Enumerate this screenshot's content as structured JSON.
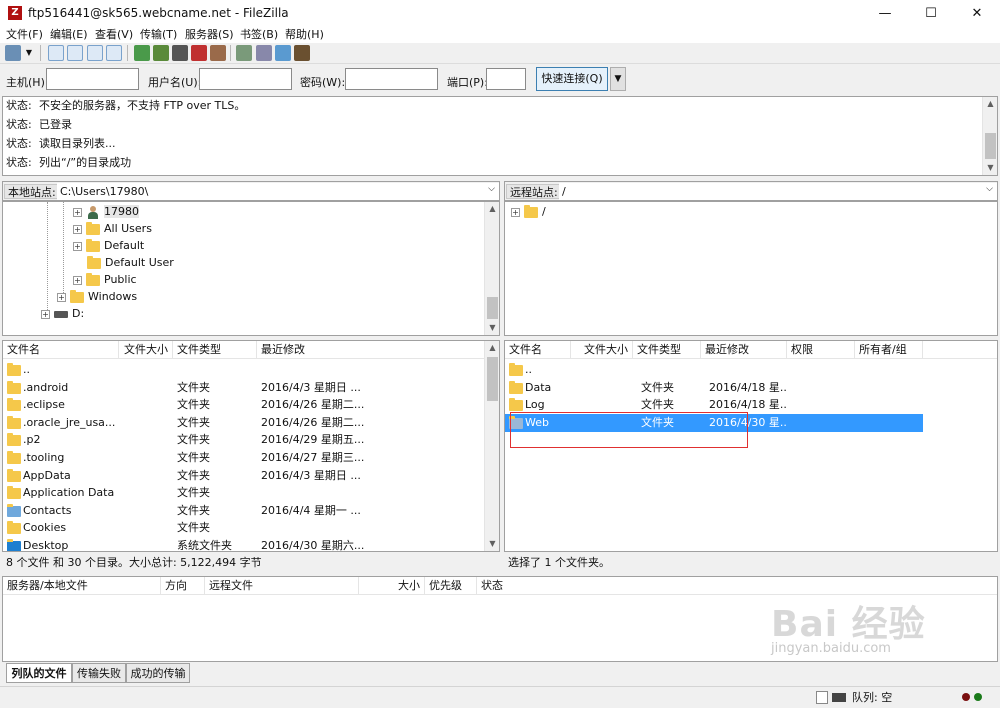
{
  "window": {
    "title": "ftp516441@sk565.webcname.net - FileZilla",
    "minimize": "—",
    "maximize": "☐",
    "close": "✕"
  },
  "menu": [
    "文件(F)",
    "编辑(E)",
    "查看(V)",
    "传输(T)",
    "服务器(S)",
    "书签(B)",
    "帮助(H)"
  ],
  "quickconnect": {
    "host_label": "主机(H):",
    "user_label": "用户名(U):",
    "pass_label": "密码(W):",
    "port_label": "端口(P):",
    "button": "快速连接(Q)",
    "host": "",
    "user": "",
    "pass": "",
    "port": ""
  },
  "log": [
    {
      "label": "状态:",
      "text": "不安全的服务器，不支持 FTP over TLS。"
    },
    {
      "label": "状态:",
      "text": "已登录"
    },
    {
      "label": "状态:",
      "text": "读取目录列表..."
    },
    {
      "label": "状态:",
      "text": "列出“/”的目录成功"
    }
  ],
  "local": {
    "site_label": "本地站点:",
    "path": "C:\\Users\\17980\\",
    "tree": [
      {
        "name": "17980",
        "icon": "user-icon",
        "expander": "+"
      },
      {
        "name": "All Users",
        "icon": "folder-icon",
        "expander": "+"
      },
      {
        "name": "Default",
        "icon": "folder-icon",
        "expander": "+"
      },
      {
        "name": "Default User",
        "icon": "folder-icon",
        "expander": ""
      },
      {
        "name": "Public",
        "icon": "folder-icon",
        "expander": "+"
      },
      {
        "name": "Windows",
        "icon": "folder-icon",
        "expander": "+"
      },
      {
        "name": "D:",
        "icon": "drive-icon",
        "expander": "+"
      }
    ],
    "columns": [
      "文件名",
      "文件大小",
      "文件类型",
      "最近修改"
    ],
    "files": [
      {
        "name": "..",
        "size": "",
        "type": "",
        "modified": ""
      },
      {
        "name": ".android",
        "size": "",
        "type": "文件夹",
        "modified": "2016/4/3 星期日 ..."
      },
      {
        "name": ".eclipse",
        "size": "",
        "type": "文件夹",
        "modified": "2016/4/26 星期二..."
      },
      {
        "name": ".oracle_jre_usa...",
        "size": "",
        "type": "文件夹",
        "modified": "2016/4/26 星期二..."
      },
      {
        "name": ".p2",
        "size": "",
        "type": "文件夹",
        "modified": "2016/4/29 星期五..."
      },
      {
        "name": ".tooling",
        "size": "",
        "type": "文件夹",
        "modified": "2016/4/27 星期三..."
      },
      {
        "name": "AppData",
        "size": "",
        "type": "文件夹",
        "modified": "2016/4/3 星期日 ..."
      },
      {
        "name": "Application Data",
        "size": "",
        "type": "文件夹",
        "modified": ""
      },
      {
        "name": "Contacts",
        "size": "",
        "type": "文件夹",
        "modified": "2016/4/4 星期一 ..."
      },
      {
        "name": "Cookies",
        "size": "",
        "type": "文件夹",
        "modified": ""
      },
      {
        "name": "Desktop",
        "size": "",
        "type": "系统文件夹",
        "modified": "2016/4/30 星期六..."
      }
    ],
    "status": "8 个文件 和 30 个目录。大小总计: 5,122,494 字节"
  },
  "remote": {
    "site_label": "远程站点:",
    "path": "/",
    "tree": [
      {
        "name": "/",
        "icon": "folder-icon",
        "expander": "+"
      }
    ],
    "columns": [
      "文件名",
      "文件大小",
      "文件类型",
      "最近修改",
      "权限",
      "所有者/组"
    ],
    "files": [
      {
        "name": "..",
        "size": "",
        "type": "",
        "modified": "",
        "perm": "",
        "owner": ""
      },
      {
        "name": "Data",
        "size": "",
        "type": "文件夹",
        "modified": "2016/4/18 星...",
        "perm": "",
        "owner": ""
      },
      {
        "name": "Log",
        "size": "",
        "type": "文件夹",
        "modified": "2016/4/18 星...",
        "perm": "",
        "owner": ""
      },
      {
        "name": "Web",
        "size": "",
        "type": "文件夹",
        "modified": "2016/4/30 星...",
        "perm": "",
        "owner": ""
      }
    ],
    "selected_index": 3,
    "status": "选择了 1 个文件夹。"
  },
  "queue": {
    "columns": [
      "服务器/本地文件",
      "方向",
      "远程文件",
      "大小",
      "优先级",
      "状态"
    ]
  },
  "tabs": [
    "列队的文件",
    "传输失败",
    "成功的传输"
  ],
  "statusbar": {
    "queue": "队列: 空"
  },
  "watermark": {
    "text": "Bai 经验",
    "url": "jingyan.baidu.com"
  },
  "colors": {
    "selection": "#3399ff",
    "highlight_box": "#e03030",
    "folder": "#f5c84a"
  }
}
